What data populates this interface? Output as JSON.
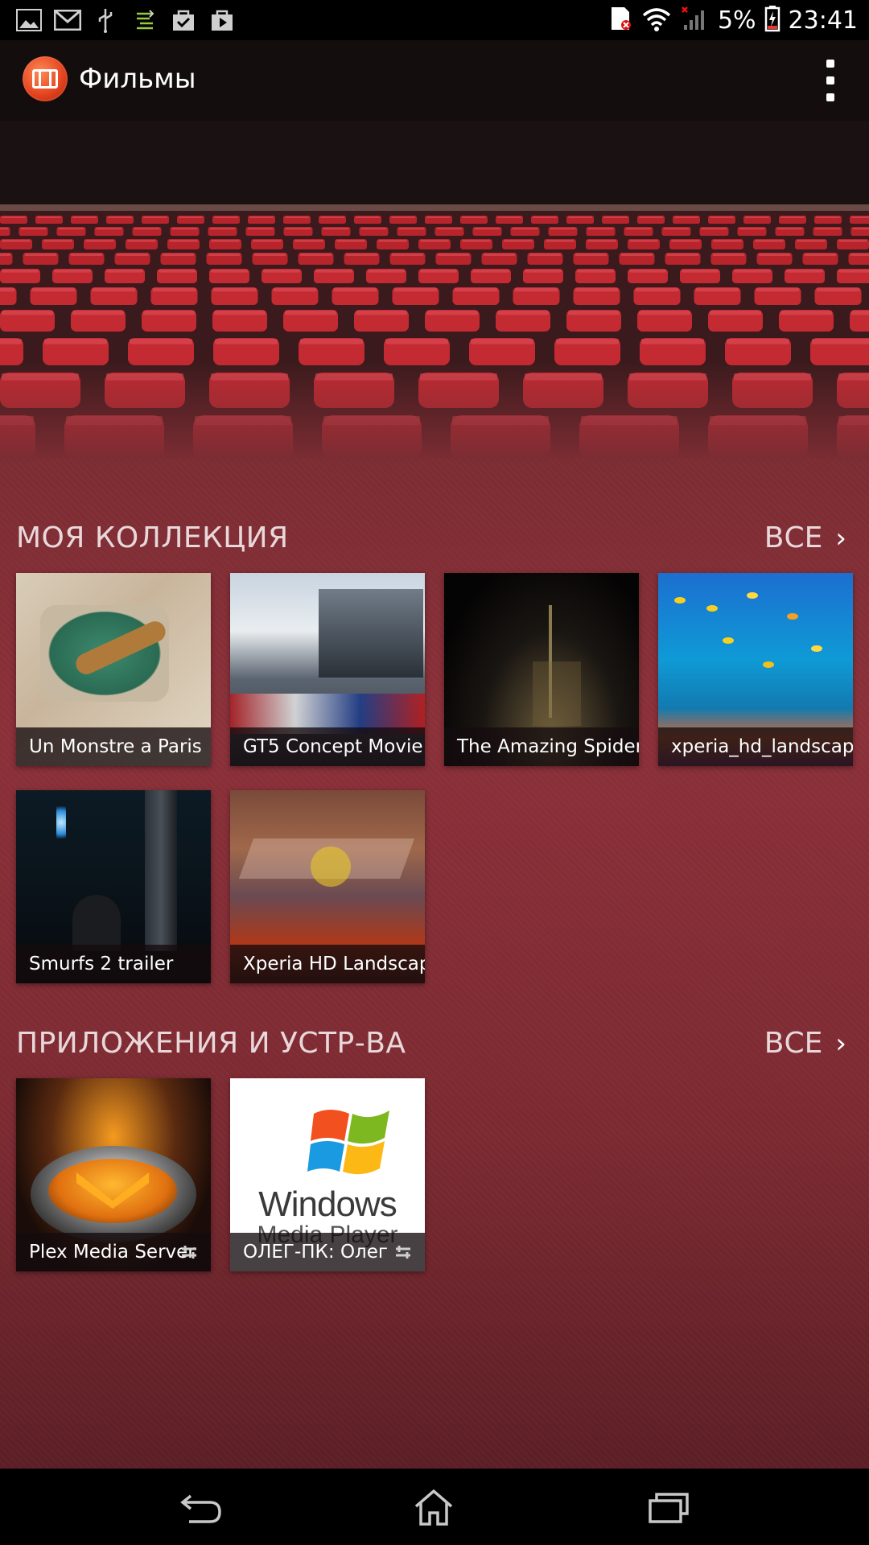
{
  "status_bar": {
    "battery_percent": "5%",
    "time": "23:41",
    "left_icons": [
      "gallery-icon",
      "gmail-icon",
      "usb-icon",
      "data-sync-icon",
      "tasks-icon",
      "play-store-icon"
    ],
    "right_icons": [
      "sim-error-icon",
      "wifi-icon",
      "signal-icon",
      "battery-charging-icon"
    ]
  },
  "action_bar": {
    "title": "Фильмы"
  },
  "collection": {
    "title": "МОЯ КОЛЛЕКЦИЯ",
    "all_label": "ВСЕ",
    "items": [
      {
        "label": "Un Monstre a Paris"
      },
      {
        "label": "GT5 Concept Movie"
      },
      {
        "label": "The Amazing Spider"
      },
      {
        "label": "xperia_hd_landscape"
      },
      {
        "label": "Smurfs 2 trailer"
      },
      {
        "label": "Xperia HD Landscape"
      }
    ]
  },
  "apps": {
    "title": "ПРИЛОЖЕНИЯ И УСТР-ВА",
    "all_label": "ВСЕ",
    "items": [
      {
        "label": "Plex Media Server"
      },
      {
        "label": "ОЛЕГ-ПК: Олег"
      }
    ],
    "wmp_logo_text": "Windows",
    "wmp_logo_subtext": "Media Player"
  },
  "colors": {
    "background": "#7b2c33",
    "accent": "#e2401c"
  }
}
